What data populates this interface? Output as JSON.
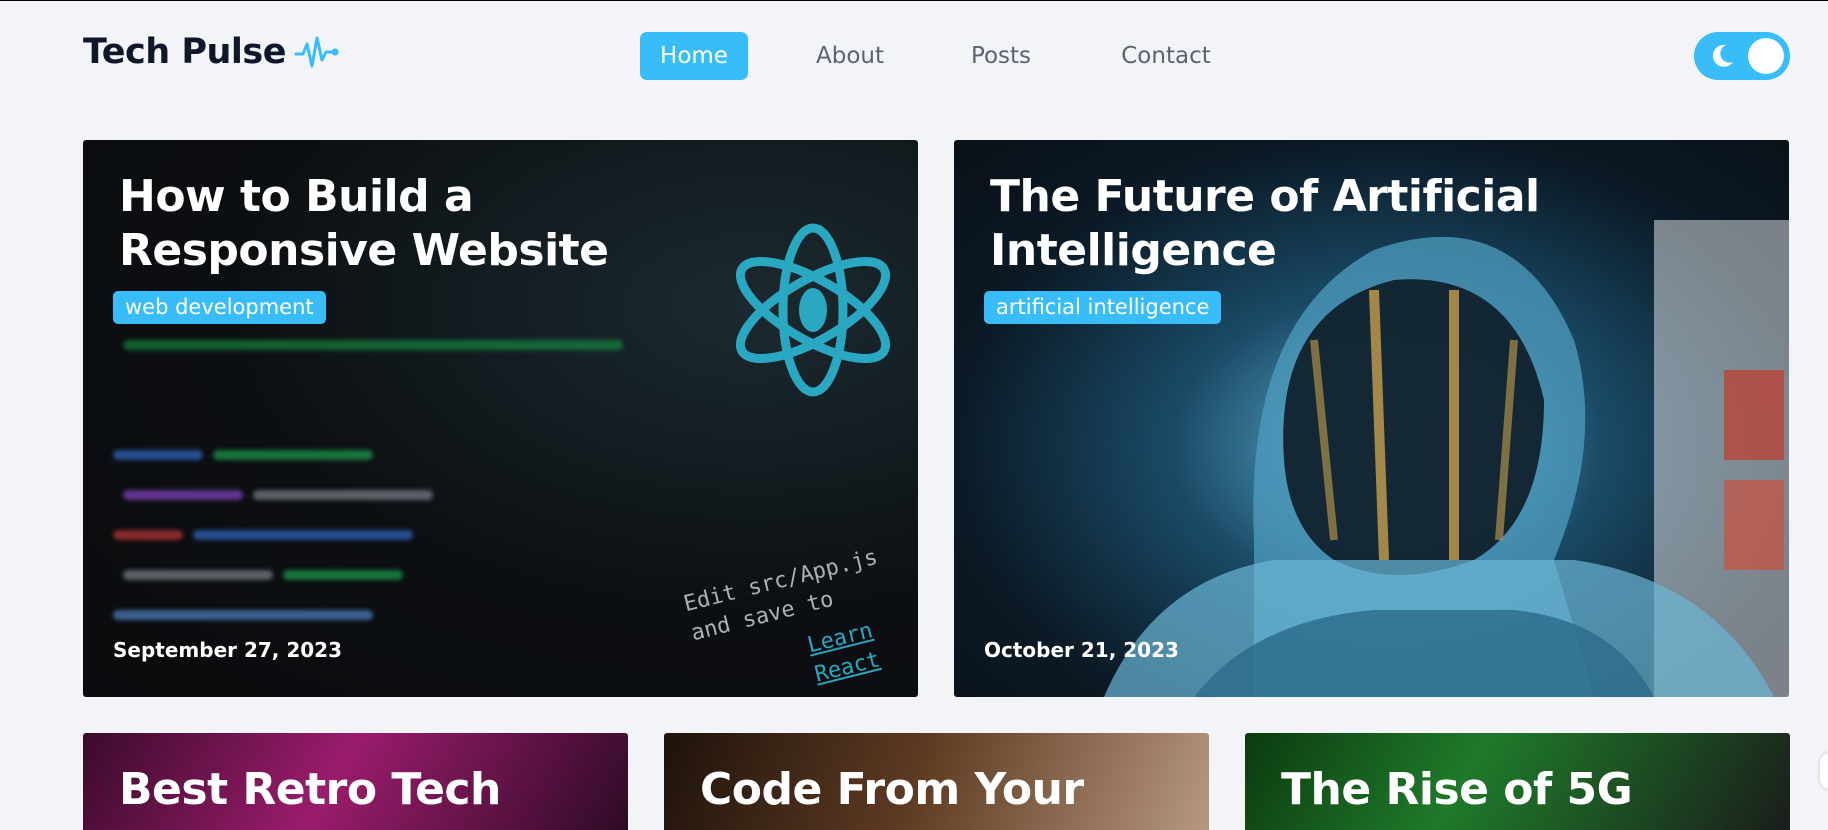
{
  "brand": {
    "name": "Tech Pulse",
    "icon": "pulse-icon",
    "accent": "#38bdf8"
  },
  "nav": {
    "items": [
      {
        "label": "Home",
        "active": true
      },
      {
        "label": "About",
        "active": false
      },
      {
        "label": "Posts",
        "active": false
      },
      {
        "label": "Contact",
        "active": false
      }
    ]
  },
  "theme_toggle": {
    "icon": "moon-icon",
    "state": "dark-mode-toggle"
  },
  "posts": [
    {
      "title": "How to Build a Responsive Website",
      "tag": "web development",
      "date": "September 27, 2023",
      "image_text": {
        "caption": "Edit src/App.js and save to",
        "link": "Learn React"
      }
    },
    {
      "title": "The Future of Artificial Intelligence",
      "tag": "artificial intelligence",
      "date": "October 21, 2023"
    },
    {
      "title": "Best Retro Tech"
    },
    {
      "title": "Code From Your"
    },
    {
      "title": "The Rise of 5G"
    }
  ]
}
